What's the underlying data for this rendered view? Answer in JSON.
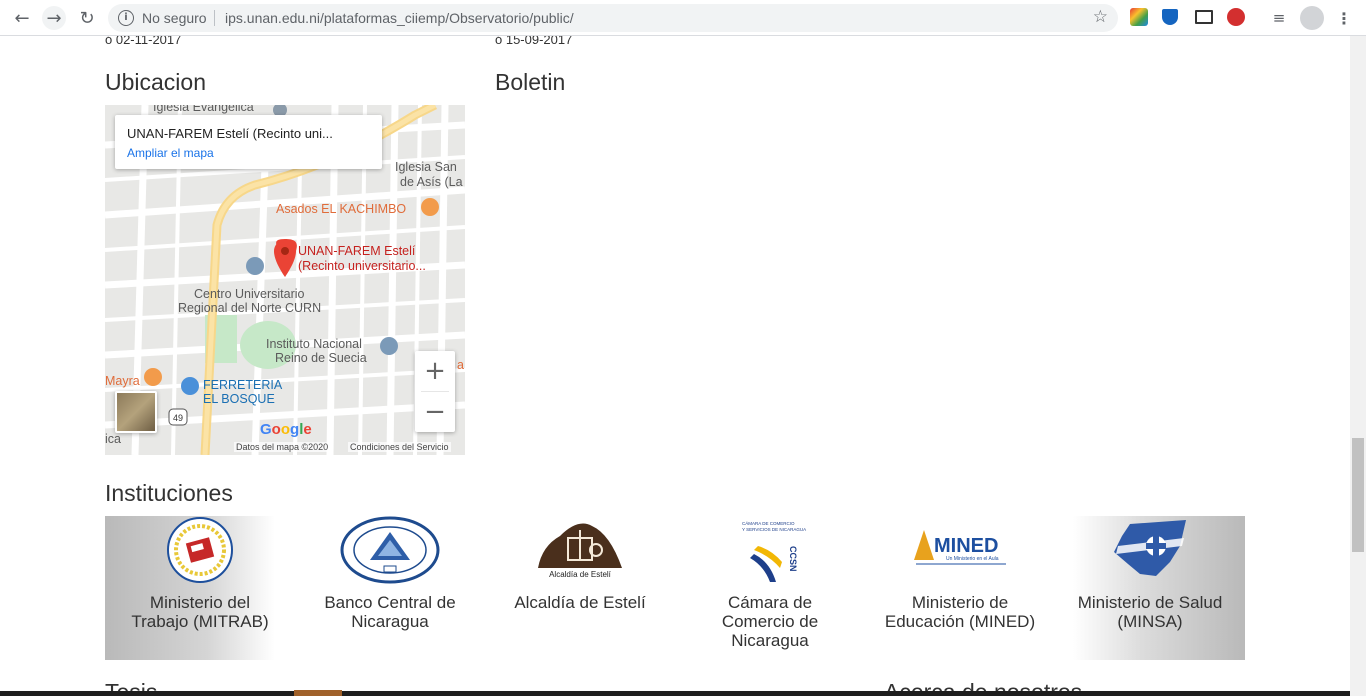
{
  "browser": {
    "security_label": "No seguro",
    "url": "ips.unan.edu.ni/plataformas_ciiemp/Observatorio/public/"
  },
  "dates": {
    "left": "02-11-2017",
    "right": "15-09-2017"
  },
  "sections": {
    "location": "Ubicacion",
    "bulletin": "Boletin",
    "institutions": "Instituciones",
    "theses": "Tesis",
    "about": "Acerca de nosotros"
  },
  "map": {
    "place_name": "UNAN-FAREM Estelí (Recinto uni...",
    "enlarge_link": "Ampliar el mapa",
    "labels": {
      "iglesia_evangelica": "Iglesia Evangelica",
      "iglesia_san": "Iglesia San",
      "de_asis": "de Asís (La",
      "asados": "Asados EL KACHIMBO",
      "unan_line1": "UNAN-FAREM Estelí",
      "unan_line2": "(Recinto universitario...",
      "curn_line1": "Centro Universitario",
      "curn_line2": "Regional del Norte CURN",
      "instituto_line1": "Instituto Nacional",
      "instituto_line2": "Reino de Suecia",
      "mayra": "Mayra",
      "ferreteria_line1": "FERRETERIA",
      "ferreteria_line2": "EL BOSQUE",
      "route": "49",
      "edge_right": "a",
      "edge_left": "ica"
    },
    "zoom_in": "+",
    "zoom_out": "−",
    "google_logo": "Google",
    "map_data": "Datos del mapa ©2020",
    "terms": "Condiciones del Servicio"
  },
  "institutions": [
    {
      "line1": "Ministerio del",
      "line2": "Trabajo (MITRAB)",
      "line3": ""
    },
    {
      "line1": "Banco Central de",
      "line2": "Nicaragua",
      "line3": ""
    },
    {
      "line1": "Alcaldía de Estelí",
      "line2": "",
      "line3": ""
    },
    {
      "line1": "Cámara de",
      "line2": "Comercio de",
      "line3": "Nicaragua"
    },
    {
      "line1": "Ministerio de",
      "line2": "Educación (MINED)",
      "line3": ""
    },
    {
      "line1": "Ministerio de Salud",
      "line2": "(MINSA)",
      "line3": ""
    }
  ],
  "logo_text": {
    "alcaldia": "Alcaldía de Estelí",
    "mined": "MINED",
    "mined_tagline": "Un Ministerio en el Aula",
    "ccsn": "CCSN",
    "ccsn_caption": "CÁMARA DE COMERCIO Y SERVICIOS DE NICARAGUA"
  }
}
